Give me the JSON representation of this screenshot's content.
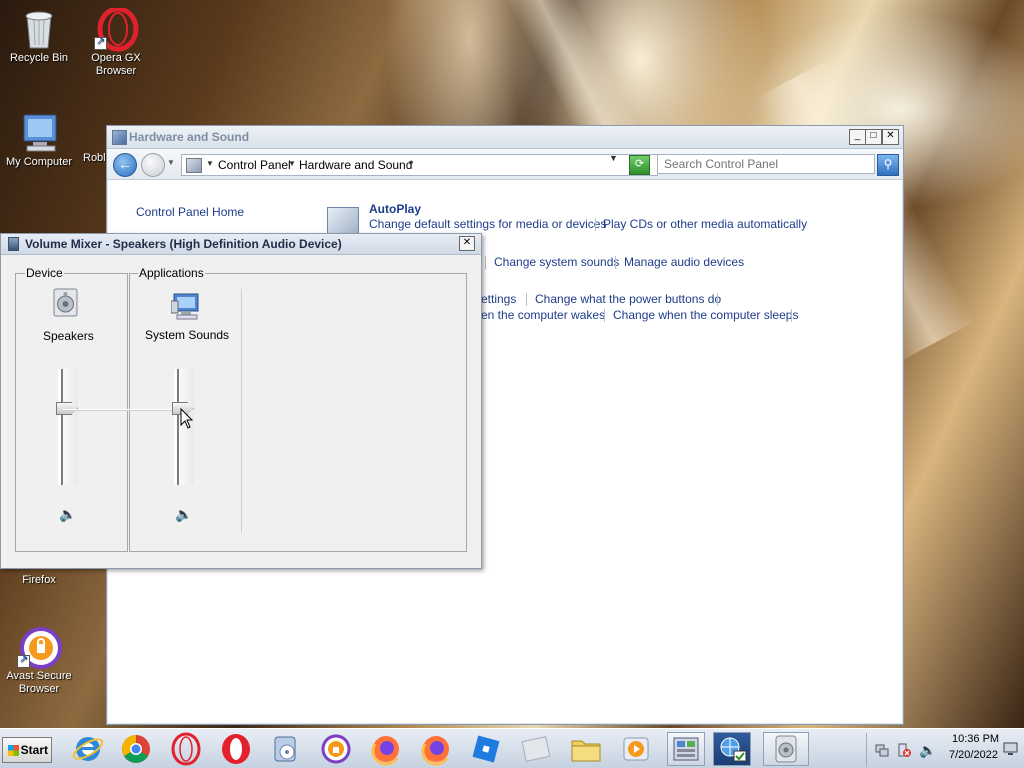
{
  "desktop": {
    "icons": [
      {
        "label": "Recycle Bin",
        "icon": "recycle-bin-icon"
      },
      {
        "label": "Opera GX Browser",
        "icon": "opera-gx-icon"
      },
      {
        "label": "My Computer",
        "icon": "my-computer-icon"
      },
      {
        "label": "Robl",
        "icon": "roblox-icon"
      },
      {
        "label": "Firefox",
        "icon": "firefox-icon"
      },
      {
        "label": "Avast Secure Browser",
        "icon": "avast-browser-icon"
      }
    ]
  },
  "control_panel": {
    "window_title": "Hardware and Sound",
    "breadcrumb": [
      "Control Panel",
      "Hardware and Sound"
    ],
    "search_placeholder": "Search Control Panel",
    "home_link": "Control Panel Home",
    "categories": [
      {
        "title": "AutoPlay",
        "links": [
          "Change default settings for media or devices",
          "Play CDs or other media automatically"
        ]
      },
      {
        "title": "",
        "links": [
          "Change system sounds",
          "Manage audio devices"
        ]
      },
      {
        "title": "",
        "links": [
          "ettings",
          "Change what the power buttons do",
          "en the computer wakes",
          "Change when the computer sleeps"
        ]
      }
    ]
  },
  "volume_mixer": {
    "title": "Volume Mixer - Speakers (High Definition Audio Device)",
    "device_group": "Device",
    "applications_group": "Applications",
    "device_name": "Speakers",
    "app_name": "System Sounds",
    "device_volume_pct": 67,
    "app_volume_pct": 67,
    "device_muted": false,
    "app_muted": false
  },
  "taskbar": {
    "start_label": "Start",
    "apps": [
      "internet-explorer-icon",
      "chrome-icon",
      "opera-icon",
      "opera-red-icon",
      "media-player-icon",
      "avast-browser-icon",
      "firefox-icon",
      "firefox-alt-icon",
      "roblox-icon",
      "blank-app-icon",
      "folder-icon",
      "video-player-icon",
      "control-panel-icon",
      "network-icon",
      "volume-mixer-icon"
    ],
    "active_app": "volume-mixer-icon",
    "clock_time": "10:36 PM",
    "clock_date": "7/20/2022"
  },
  "colors": {
    "link": "#1d3d8b",
    "accent_blue": "#2a6fc0",
    "taskbar": "#c5d1e0"
  }
}
